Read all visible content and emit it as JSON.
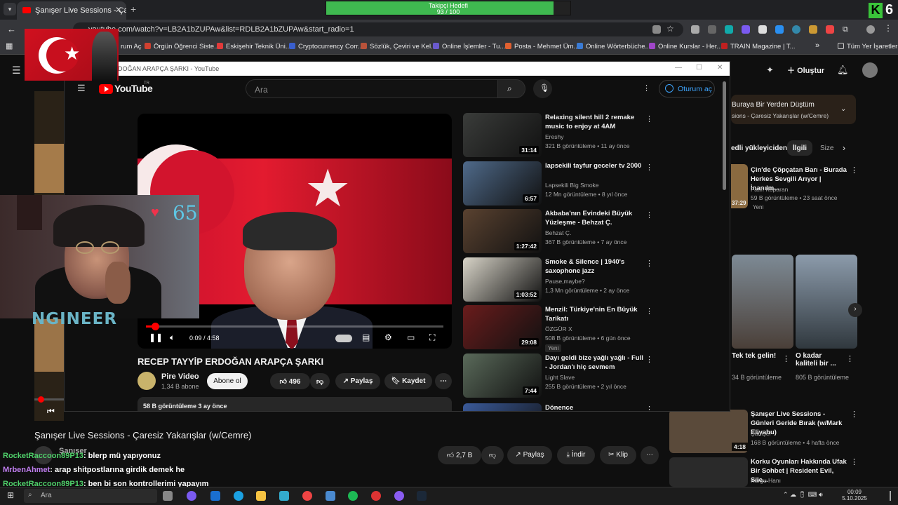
{
  "browser": {
    "tab_title": "Şanışer Live Sessions - Çaresiz Y",
    "url": "youtube.com/watch?v=LB2A1bZUPAw&list=RDLB2A1bZUPAw&start_radio=1",
    "bookmarks": [
      "rum Aç",
      "Örgün Öğrenci Siste...",
      "Eskişehir Teknik Üni...",
      "Cryptocurrency Corr...",
      "Sözlük, Çeviri ve Kel...",
      "Online İşlemler - Tu...",
      "Posta - Mehmet Üm...",
      "Online Wörterbüche...",
      "Online Kurslar - Her...",
      "TRAIN Magazine | T..."
    ],
    "bookmark_colors": [
      "#e05050",
      "#d04030",
      "#e23a3a",
      "#3a5fcd",
      "#b8523a",
      "#6a5acd",
      "#e06030",
      "#3a7bd5",
      "#a046c8",
      "#c02020"
    ],
    "all_bookmarks": "Tüm Yer İşaretleri"
  },
  "goal": {
    "label": "Takipçi Hedefi",
    "progress": "93 / 100",
    "fraction": 0.93
  },
  "popup": {
    "window_title": "DOĞAN ARAPÇA ŞARKI - YouTube",
    "logo": "YouTube",
    "logo_region": "TR",
    "search_placeholder": "Ara",
    "signin": "Oturum aç",
    "video": {
      "time": "0:09 / 4:58",
      "played_fraction": 0.03,
      "title": "RECEP TAYYİP ERDOĞAN ARAPÇA ŞARKI",
      "channel": "Pire Video",
      "subs": "1,34 B abone",
      "subscribe": "Abone ol",
      "likes": "496",
      "share": "Paylaş",
      "save": "Kaydet",
      "views": "58 B görüntüleme  3 ay önce"
    },
    "recs": [
      {
        "title": "Relaxing silent hill 2 remake music to enjoy at 4AM",
        "channel": "Ereshy",
        "meta": "321 B görüntüleme • 11 ay önce",
        "duration": "31:14",
        "thumb": "#3a3c3a",
        "new": ""
      },
      {
        "title": "lapsekili tayfur geceler tv 2000",
        "channel": "Lapsekili Big Smoke",
        "meta": "12 Mn görüntüleme • 8 yıl önce",
        "duration": "6:57",
        "thumb": "#4f6a8a",
        "new": ""
      },
      {
        "title": "Akbaba'nın Evindeki Büyük Yüzleşme - Behzat Ç.",
        "channel": "Behzat Ç.",
        "meta": "367 B görüntüleme • 7 ay önce",
        "duration": "1:27:42",
        "thumb": "#5a4230",
        "new": ""
      },
      {
        "title": "Smoke & Silence  |  1940's saxophone jazz",
        "channel": "Pause,maybe?",
        "meta": "1,3 Mn görüntüleme • 2 ay önce",
        "duration": "1:03:52",
        "thumb": "#d8d4c8",
        "new": ""
      },
      {
        "title": "Menzil: Türkiye'nin En Büyük Tarikatı",
        "channel": "ÖZGÜR X",
        "meta": "508 B görüntüleme • 6 gün önce",
        "duration": "29:08",
        "thumb": "#6a1c1c",
        "new": "Yeni"
      },
      {
        "title": "Dayı geldi bize yağlı yağlı - Full - Jordan'ı hiç sevmem",
        "channel": "Light Slave",
        "meta": "255 B görüntüleme • 2 yıl önce",
        "duration": "7:44",
        "thumb": "#5a6a5a",
        "new": ""
      },
      {
        "title": "Dönence",
        "channel": "",
        "meta": "",
        "duration": "",
        "thumb": "#3a5a9a",
        "new": ""
      }
    ]
  },
  "overlay": {
    "heart_count": "65",
    "brand": "NGINEER",
    "k_digit": "6"
  },
  "chat": [
    {
      "user": "RocketRaccoon89P13",
      "msg": ": blerp mü yapıyonuz"
    },
    {
      "user": "MrbenAhmet",
      "msg": ": arap shitpostlarına girdik demek he"
    },
    {
      "user": "RocketRaccoon89P13",
      "msg": ": ben bi son kontrollerimi yapayım"
    }
  ],
  "background": {
    "title": "Şanışer Live Sessions - Çaresiz Yakarışlar (w/Cemre)",
    "channel": "Şanışer",
    "likes": "2,7 B",
    "share": "Paylaş",
    "download": "İndir",
    "clip": "Klip",
    "create": "Oluştur",
    "playlist_title": "Buraya Bir Yerden Düştüm",
    "playlist_sub": "sions - Çaresiz Yakarışlar (w/Cemre)",
    "filters": [
      "edli yükleyiciden",
      "İlgili",
      "Size"
    ],
    "side1": {
      "title": "Çin'de Çöpçatan Barı - Burada Herkes Sevgili Arıyor | İnanılm...",
      "channel": "Fatih Koparan",
      "meta": "59 B görüntüleme • 23 saat önce",
      "badge": "Yeni",
      "dur": "37:29"
    },
    "shorts": [
      {
        "title": "Tek tek gelin!",
        "views": "34 B görüntüleme"
      },
      {
        "title": "O kadar kaliteli bir ...",
        "views": "805 B görüntüleme"
      }
    ],
    "side2": {
      "title": "Şanışer Live Sessions - Günleri Geride Bırak (w/Mark Eliyahu)",
      "channel": "Şanışer",
      "meta": "168 B görüntüleme • 4 hafta önce",
      "dur": "4:18"
    },
    "side3": {
      "title": "Korku Oyunları Hakkında Ufak Bir Sohbet | Resident Evil, Sile...",
      "channel": "Kurgu Hanı"
    }
  },
  "taskbar": {
    "search": "Ara",
    "time": "00:09",
    "date": "5.10.2025"
  }
}
